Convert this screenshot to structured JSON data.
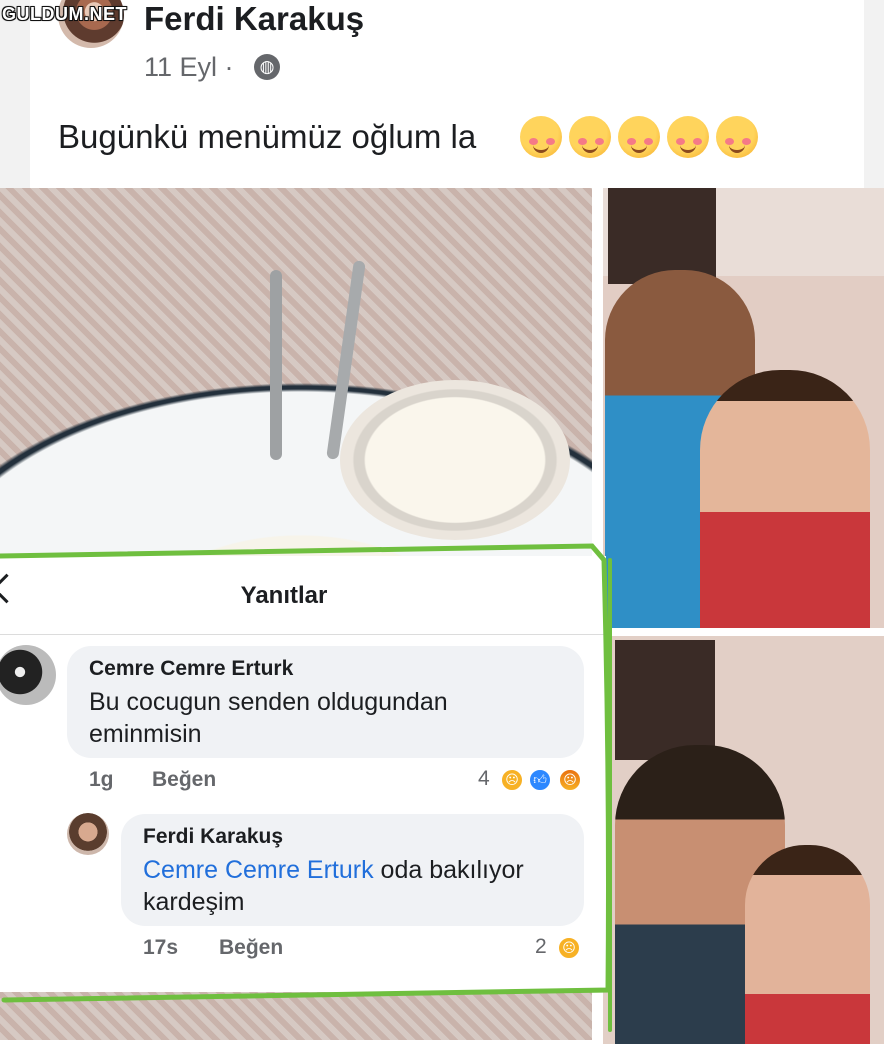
{
  "watermark": "GULDUM.NET",
  "post": {
    "author": "Ferdi Karakuş",
    "date": "11 Eyl · ",
    "privacy_icon": "globe-icon",
    "text": "Bugünkü menümüz oğlum la",
    "emoji_count": 5,
    "emoji_icon": "smiling-face-with-hearts-icon"
  },
  "replies_panel": {
    "title": "Yanıtlar",
    "back_icon": "chevron-left-icon",
    "comments": [
      {
        "author": "Cemre Cemre Erturk",
        "text": "Bu cocugun senden oldugundan eminmisin",
        "time": "1g",
        "like_label": "Beğen",
        "reaction_count": "4",
        "reactions": [
          "sad-reaction-icon",
          "like-reaction-icon",
          "angry-reaction-icon"
        ]
      },
      {
        "author": "Ferdi Karakuş",
        "mention": "Cemre Cemre Erturk",
        "text": " oda bakılıyor kardeşim",
        "time": "17s",
        "like_label": "Beğen",
        "reaction_count": "2",
        "reactions": [
          "sad-reaction-icon"
        ]
      }
    ]
  },
  "colors": {
    "mention": "#216fdb",
    "bubble": "#f0f2f5",
    "secondary_text": "#65676b",
    "highlight_stroke": "#6fbf3f"
  }
}
